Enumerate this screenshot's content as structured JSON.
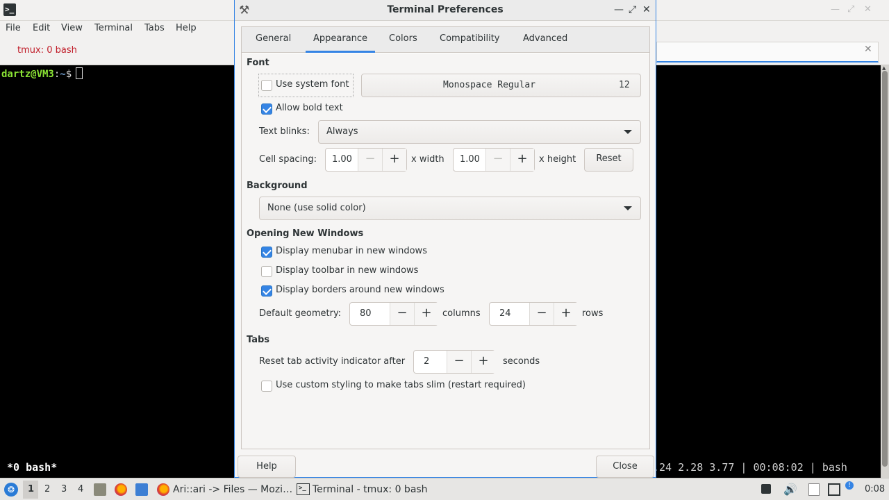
{
  "terminal": {
    "menu": [
      "File",
      "Edit",
      "View",
      "Terminal",
      "Tabs",
      "Help"
    ],
    "tab_title": "tmux: 0 bash",
    "prompt_user": "dartz@VM3",
    "prompt_sep": ":",
    "prompt_path": "~",
    "prompt_symbol": "$",
    "tmux_left": "*0 bash*",
    "tmux_right": ".24 2.28 3.77 | 00:08:02 | bash"
  },
  "dialog": {
    "title": "Terminal Preferences",
    "tabs": [
      "General",
      "Appearance",
      "Colors",
      "Compatibility",
      "Advanced"
    ],
    "active_tab": "Appearance",
    "font": {
      "heading": "Font",
      "use_system_font": "Use system font",
      "use_system_font_checked": false,
      "font_name": "Monospace Regular",
      "font_size": "12",
      "allow_bold": "Allow bold text",
      "allow_bold_checked": true,
      "text_blinks_label": "Text blinks:",
      "text_blinks_value": "Always",
      "cell_spacing_label": "Cell spacing:",
      "cell_width": "1.00",
      "x_width": "x width",
      "cell_height": "1.00",
      "x_height": "x height",
      "reset": "Reset"
    },
    "background": {
      "heading": "Background",
      "value": "None (use solid color)"
    },
    "new_windows": {
      "heading": "Opening New Windows",
      "menubar": "Display menubar in new windows",
      "menubar_checked": true,
      "toolbar": "Display toolbar in new windows",
      "toolbar_checked": false,
      "borders": "Display borders around new windows",
      "borders_checked": true,
      "geometry_label": "Default geometry:",
      "columns_value": "80",
      "columns_label": "columns",
      "rows_value": "24",
      "rows_label": "rows"
    },
    "tabs_section": {
      "heading": "Tabs",
      "reset_label": "Reset tab activity indicator after",
      "reset_value": "2",
      "seconds": "seconds",
      "slim": "Use custom styling to make tabs slim (restart required)",
      "slim_checked": false
    },
    "help_button": "Help",
    "close_button": "Close"
  },
  "taskbar": {
    "workspaces": [
      "1",
      "2",
      "3",
      "4"
    ],
    "active_workspace": "1",
    "task_firefox": "Ari::ari -> Files — Mozi…",
    "task_terminal": "Terminal - tmux: 0 bash",
    "clock": "0:08"
  },
  "colors": {
    "accent": "#3584e4",
    "prompt_user": "#8ae234",
    "prompt_path": "#729fcf",
    "tab_title": "#c01c28"
  }
}
